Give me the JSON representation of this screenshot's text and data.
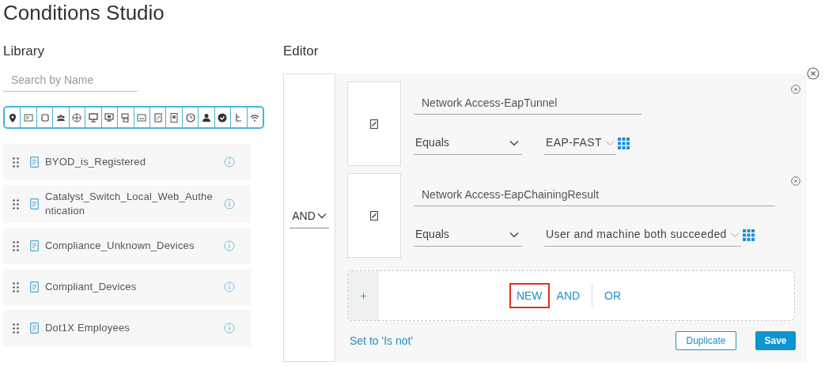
{
  "title": "Conditions Studio",
  "library": {
    "heading": "Library",
    "search": {
      "placeholder": "Search by Name"
    },
    "items": [
      {
        "name": "BYOD_is_Registered"
      },
      {
        "name": "Catalyst_Switch_Local_Web_Authentication"
      },
      {
        "name": "Compliance_Unknown_Devices"
      },
      {
        "name": "Compliant_Devices"
      },
      {
        "name": "Dot1X Employees"
      }
    ]
  },
  "editor": {
    "heading": "Editor",
    "operator": "AND",
    "conditions": [
      {
        "attribute": "Network Access-EapTunnel",
        "operator": "Equals",
        "value": "EAP-FAST"
      },
      {
        "attribute": "Network Access-EapChainingResult",
        "operator": "Equals",
        "value": "User and machine both succeeded"
      }
    ],
    "add_icon": "+",
    "add_actions": [
      {
        "label": "NEW",
        "highlighted": true
      },
      {
        "label": "AND",
        "highlighted": false
      },
      {
        "label": "OR",
        "highlighted": false
      }
    ],
    "negate_link": "Set to 'Is not'",
    "buttons": [
      {
        "label": "Duplicate",
        "kind": "secondary"
      },
      {
        "label": "Save",
        "kind": "primary"
      }
    ]
  }
}
